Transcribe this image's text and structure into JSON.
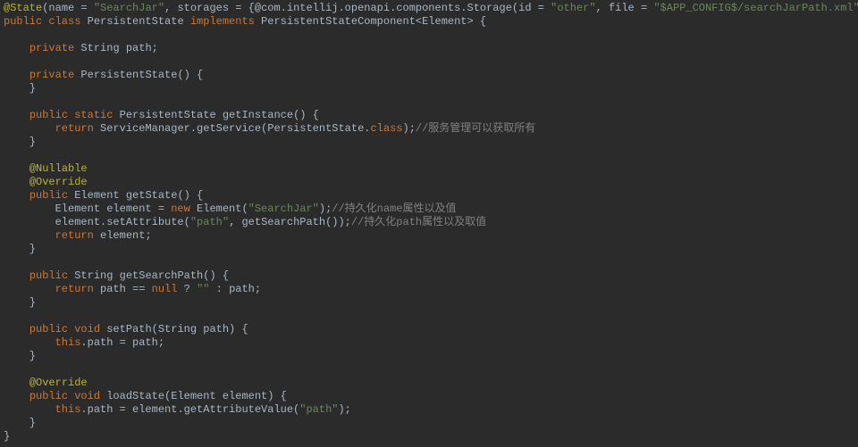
{
  "code": {
    "annotation_state": "@State",
    "state_params_open": "(name = ",
    "state_name": "\"SearchJar\"",
    "state_mid": ", storages = {@com.intellij.openapi.components.Storage(id = ",
    "storage_id": "\"other\"",
    "state_mid2": ", file = ",
    "storage_file": "\"$APP_CONFIG$/searchJarPath.xml\"",
    "state_close": ")})",
    "l2a": "public class",
    "l2b": " PersistentState ",
    "l2c": "implements",
    "l2d": " PersistentStateComponent<Element> {",
    "l4a": "private",
    "l4b": " String path;",
    "l6a": "private",
    "l6b": " PersistentState() {",
    "l7": "    }",
    "l9a": "public static",
    "l9b": " PersistentState getInstance() {",
    "l10a": "return",
    "l10b": " ServiceManager.getService(PersistentState.",
    "l10c": "class",
    "l10d": ");",
    "l10cmt": "//服务管理可以获取所有",
    "l11": "    }",
    "ann_nullable": "@Nullable",
    "ann_override1": "@Override",
    "l15a": "public",
    "l15b": " Element getState() {",
    "l16a": "        Element element = ",
    "l16b": "new",
    "l16c": " Element(",
    "l16str": "\"SearchJar\"",
    "l16d": ");",
    "l16cmt": "//持久化name属性以及值",
    "l17a": "        element.setAttribute(",
    "l17str": "\"path\"",
    "l17b": ", getSearchPath());",
    "l17cmt": "//持久化path属性以及取值",
    "l18a": "return",
    "l18b": " element;",
    "l19": "    }",
    "l21a": "public",
    "l21b": " String getSearchPath() {",
    "l22a": "return",
    "l22b": " path == ",
    "l22c": "null",
    "l22d": " ? ",
    "l22e": "\"\"",
    "l22f": " : path;",
    "l23": "    }",
    "l25a": "public void",
    "l25b": " setPath(String path) {",
    "l26a": "this",
    "l26b": ".path = path;",
    "l27": "    }",
    "ann_override2": "@Override",
    "l30a": "public void",
    "l30b": " loadState(Element element) {",
    "l31a": "this",
    "l31b": ".path = element.getAttributeValue(",
    "l31str": "\"path\"",
    "l31c": ");",
    "l32": "    }",
    "l33": "}"
  }
}
